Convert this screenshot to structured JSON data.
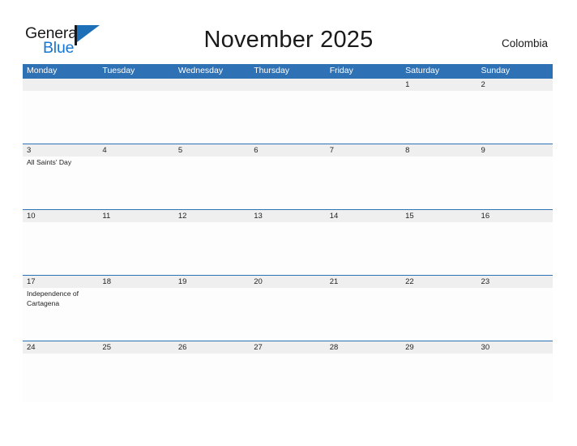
{
  "brand": {
    "name_part1": "General",
    "name_part2": "Blue",
    "mark_icon": "flag-triangle-icon",
    "accent_color": "#1d6fb8",
    "blue_text_color": "#1577d2"
  },
  "header": {
    "title": "November 2025",
    "country": "Colombia"
  },
  "calendar": {
    "header_bg_color": "#2e71b5",
    "band_bg_color": "#efefef",
    "weekdays": [
      "Monday",
      "Tuesday",
      "Wednesday",
      "Thursday",
      "Friday",
      "Saturday",
      "Sunday"
    ],
    "weeks": [
      {
        "days": [
          {
            "num": "",
            "events": []
          },
          {
            "num": "",
            "events": []
          },
          {
            "num": "",
            "events": []
          },
          {
            "num": "",
            "events": []
          },
          {
            "num": "",
            "events": []
          },
          {
            "num": "1",
            "events": []
          },
          {
            "num": "2",
            "events": []
          }
        ]
      },
      {
        "days": [
          {
            "num": "3",
            "events": [
              "All Saints' Day"
            ]
          },
          {
            "num": "4",
            "events": []
          },
          {
            "num": "5",
            "events": []
          },
          {
            "num": "6",
            "events": []
          },
          {
            "num": "7",
            "events": []
          },
          {
            "num": "8",
            "events": []
          },
          {
            "num": "9",
            "events": []
          }
        ]
      },
      {
        "days": [
          {
            "num": "10",
            "events": []
          },
          {
            "num": "11",
            "events": []
          },
          {
            "num": "12",
            "events": []
          },
          {
            "num": "13",
            "events": []
          },
          {
            "num": "14",
            "events": []
          },
          {
            "num": "15",
            "events": []
          },
          {
            "num": "16",
            "events": []
          }
        ]
      },
      {
        "days": [
          {
            "num": "17",
            "events": [
              "Independence of Cartagena"
            ]
          },
          {
            "num": "18",
            "events": []
          },
          {
            "num": "19",
            "events": []
          },
          {
            "num": "20",
            "events": []
          },
          {
            "num": "21",
            "events": []
          },
          {
            "num": "22",
            "events": []
          },
          {
            "num": "23",
            "events": []
          }
        ]
      },
      {
        "days": [
          {
            "num": "24",
            "events": []
          },
          {
            "num": "25",
            "events": []
          },
          {
            "num": "26",
            "events": []
          },
          {
            "num": "27",
            "events": []
          },
          {
            "num": "28",
            "events": []
          },
          {
            "num": "29",
            "events": []
          },
          {
            "num": "30",
            "events": []
          }
        ]
      }
    ]
  }
}
